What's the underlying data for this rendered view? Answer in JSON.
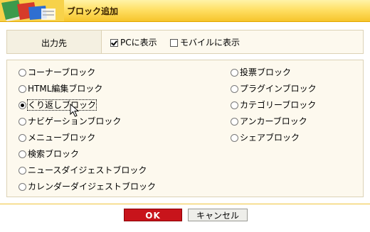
{
  "dialog": {
    "title": "ブロック追加"
  },
  "destination": {
    "label": "出力先",
    "options": [
      {
        "label": "PCに表示",
        "checked": true
      },
      {
        "label": "モバイルに表示",
        "checked": false
      }
    ]
  },
  "blocks": {
    "left": [
      {
        "label": "コーナーブロック",
        "selected": false
      },
      {
        "label": "HTML編集ブロック",
        "selected": false
      },
      {
        "label": "くり返しブロック",
        "selected": true
      },
      {
        "label": "ナビゲーションブロック",
        "selected": false
      },
      {
        "label": "メニューブロック",
        "selected": false
      },
      {
        "label": "検索ブロック",
        "selected": false
      },
      {
        "label": "ニュースダイジェストブロック",
        "selected": false
      },
      {
        "label": "カレンダーダイジェストブロック",
        "selected": false
      }
    ],
    "right": [
      {
        "label": "投票ブロック",
        "selected": false
      },
      {
        "label": "プラグインブロック",
        "selected": false
      },
      {
        "label": "カテゴリーブロック",
        "selected": false
      },
      {
        "label": "アンカーブロック",
        "selected": false
      },
      {
        "label": "シェアブロック",
        "selected": false
      }
    ]
  },
  "buttons": {
    "ok": "OK",
    "cancel": "キャンセル"
  },
  "colors": {
    "title_bar": "#f6c52c",
    "ok_button": "#c8141b",
    "panel_bg": "#fdf9ee"
  },
  "icons": {
    "title": "books-icon"
  }
}
